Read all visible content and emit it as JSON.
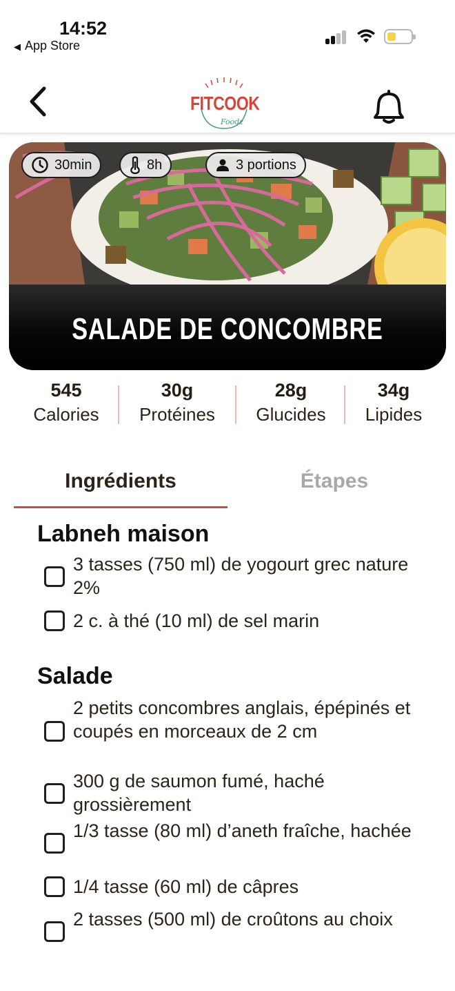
{
  "status": {
    "time": "14:52",
    "back_app": "App Store",
    "back_arrow": "◀"
  },
  "nav": {
    "logo_text": "FITCOOK",
    "logo_sub": "Foodz"
  },
  "recipe": {
    "title": "SALADE DE CONCOMBRE",
    "chips": {
      "time": "30min",
      "rest": "8h",
      "portions": "3 portions"
    }
  },
  "macros": [
    {
      "value": "545",
      "label": "Calories"
    },
    {
      "value": "30g",
      "label": "Protéines"
    },
    {
      "value": "28g",
      "label": "Glucides"
    },
    {
      "value": "34g",
      "label": "Lipides"
    }
  ],
  "tabs": {
    "ingredients": "Ingrédients",
    "steps": "Étapes"
  },
  "sections": [
    {
      "title": "Labneh maison",
      "items": [
        "3 tasses (750 ml) de yogourt grec nature 2%",
        "2 c. à thé (10 ml) de sel marin"
      ]
    },
    {
      "title": "Salade",
      "items": [
        "2 petits concombres anglais, épépinés et coupés en morceaux de 2 cm",
        "300 g de saumon fumé, haché grossièrement",
        "1/3 tasse (80 ml) d’aneth fraîche, hachée",
        "1/4 tasse (60 ml) de câpres",
        "2 tasses (500 ml) de croûtons au choix"
      ]
    }
  ],
  "colors": {
    "accent": "#d14a43",
    "divider": "#f0b7b3",
    "logo_red": "#d4453a",
    "logo_green": "#3d9e7e"
  }
}
